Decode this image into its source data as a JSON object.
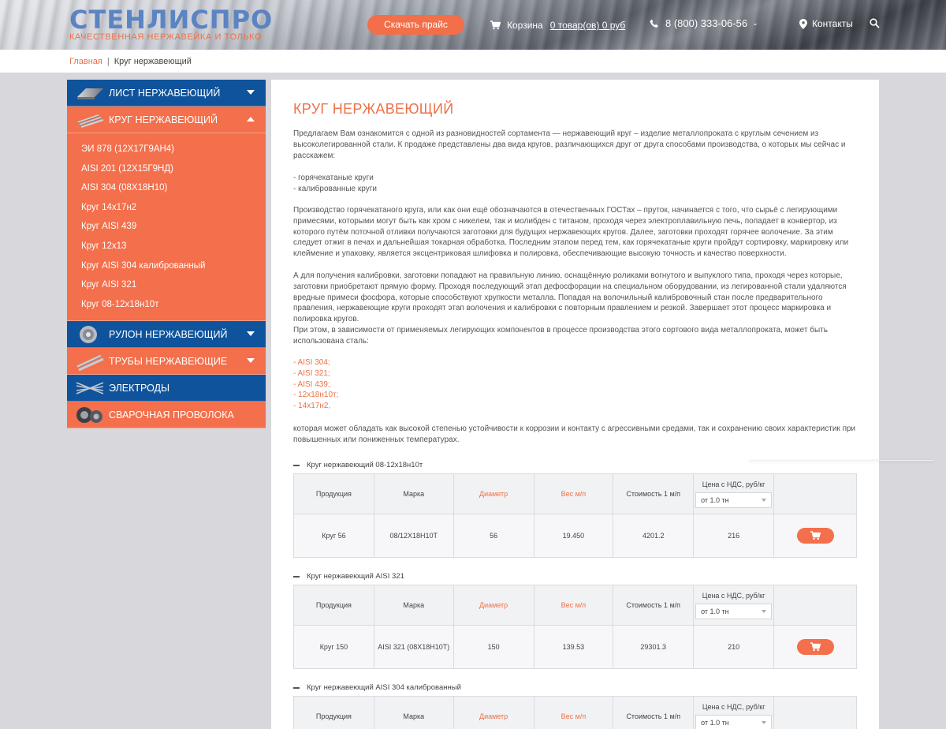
{
  "header": {
    "logo_main": "СТЕНЛИСПРО",
    "logo_sub": "КАЧЕСТВЕННАЯ НЕРЖАВЕЙКА И ТОЛЬКО",
    "price_button": "Скачать прайс",
    "cart_label": "Корзина",
    "cart_link": "0 товар(ов) 0 руб",
    "phone": "8 (800) 333-06-56",
    "contacts": "Контакты"
  },
  "breadcrumb": {
    "home": "Главная",
    "separator": "|",
    "current": "Круг нержавеющий"
  },
  "sidebar": {
    "categories": [
      {
        "label": "ЛИСТ НЕРЖАВЕЮЩИЙ",
        "color": "#0e539c",
        "icon": "sheet-metal-icon"
      },
      {
        "label": "КРУГ НЕРЖАВЕЮЩИЙ",
        "color": "#f46f4b",
        "icon": "round-bars-icon"
      },
      {
        "label": "РУЛОН НЕРЖАВЕЮЩИЙ",
        "color": "#0e539c",
        "icon": "coil-icon"
      },
      {
        "label": "ТРУБЫ НЕРЖАВЕЮЩИЕ",
        "color": "#f46f4b",
        "icon": "pipes-icon"
      },
      {
        "label": "ЭЛЕКТРОДЫ",
        "color": "#0e539c",
        "icon": "electrodes-icon"
      },
      {
        "label": "СВАРОЧНАЯ ПРОВОЛОКА",
        "color": "#f46f4b",
        "icon": "wire-spool-icon"
      }
    ],
    "subitems": [
      "ЭИ 878 (12Х17Г9АН4)",
      "AISI 201 (12Х15Г9НД)",
      "AISI 304 (08Х18Н10)",
      "Круг 14х17н2",
      "Круг AISI 439",
      "Круг 12х13",
      "Круг AISI 304 калиброванный",
      "Круг AISI 321",
      "Круг 08-12х18н10т"
    ]
  },
  "content": {
    "title": "КРУГ НЕРЖАВЕЮЩИЙ",
    "para1": "Предлагаем Вам ознакомится с одной из разновидностей сортамента — нержавеющий круг – изделие металлопроката с круглым сечением из высоколегированной стали. К продаже представлены два вида кругов, различающихся друг от друга способами производства, о которых мы сейчас и расскажем:",
    "list1": [
      "- горячекатаные круги",
      "- калиброванные круги"
    ],
    "para2": "Производство горячекатаного круга, или как они ещё обозначаются в отечественных ГОСТах – пруток, начинается с того, что сырьё с легирующими примесями, которыми могут быть как хром с никелем, так и молибден с титаном, проходя через электроплавильную печь, попадает в конвертор, из которого путём поточной отливки получаются заготовки для будущих нержавеющих кругов. Далее, заготовки проходят горячее волочение. За этим следует отжиг в печах и дальнейшая токарная обработка. Последним этапом перед тем, как горячекатаные круги пройдут сортировку, маркировку или клеймение и упаковку, является эксцентриковая шлифовка и полировка, обеспечивающие высокую точность и качество поверхности.",
    "para3": "А для получения калибровки, заготовки попадают на правильную линию, оснащённую роликами вогнутого и выпуклого типа, проходя через которые, заготовки приобретают прямую форму. Проходя последующий этап дефосфорации на специальном оборудовании, из легированной стали удаляются вредные примеси фосфора, которые способствуют хрупкости металла. Попадая на волочильный калибровочный стан после предварительного правления, нержавеющие круги проходят этап волочения и калибровки с повторным правлением и резкой. Завершает этот процесс маркировка и полировка кругов.",
    "para4": "При этом, в зависимости от применяемых легирующих компонентов в процессе производства этого сортового вида металлопроката, может быть использована сталь:",
    "steel_list": [
      "- AISI 304;",
      "- AISI 321;",
      "- AISI 439;",
      "- 12х18н10т;",
      "- 14х17н2,"
    ],
    "para5": "которая может обладать как высокой степенью устойчивости к коррозии и контакту с агрессивными средами, так и сохранению своих характеристик при повышенных или пониженных температурах."
  },
  "table_headers": {
    "product": "Продукция",
    "grade": "Марка",
    "diameter": "Диаметр",
    "weight": "Вес м/п",
    "cost": "Стоимость 1 м/п",
    "price": "Цена с НДС, руб/кг",
    "select_value": "от 1.0 тн"
  },
  "sections": [
    {
      "title": "Круг нержавеющий 08-12х18н10т",
      "rows": [
        {
          "product": "Круг 56",
          "grade": "08/12Х18Н10Т",
          "diameter": "56",
          "weight": "19.450",
          "cost": "4201.2",
          "price": "216"
        }
      ]
    },
    {
      "title": "Круг нержавеющий AISI 321",
      "rows": [
        {
          "product": "Круг 150",
          "grade": "AISI 321 (08Х18Н10Т)",
          "diameter": "150",
          "weight": "139.53",
          "cost": "29301.3",
          "price": "210"
        }
      ]
    },
    {
      "title": "Круг нержавеющий AISI 304 калиброванный",
      "rows": []
    }
  ],
  "colors": {
    "accent": "#f46f4b",
    "brand_blue": "#0e539c",
    "title_orange": "#ee7147"
  }
}
